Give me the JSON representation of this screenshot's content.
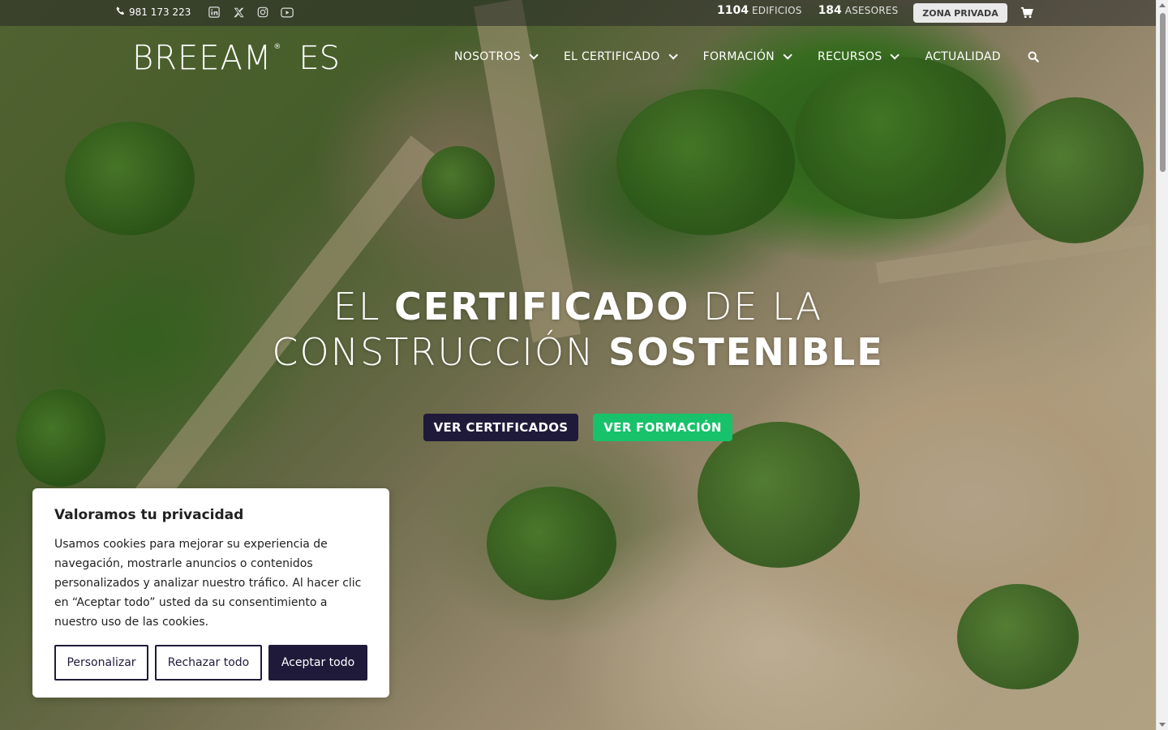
{
  "topbar": {
    "phone": "981 173 223",
    "social_icons": [
      "linkedin-icon",
      "x-icon",
      "instagram-icon",
      "youtube-icon"
    ],
    "stats": [
      {
        "value": "1104",
        "label": "EDIFICIOS"
      },
      {
        "value": "184",
        "label": "ASESORES"
      }
    ],
    "private_zone_label": "ZONA PRIVADA"
  },
  "header": {
    "logo_text": "BREEAM",
    "logo_reg": "®",
    "logo_suffix": "ES",
    "nav": [
      {
        "label": "NOSOTROS",
        "has_dropdown": true
      },
      {
        "label": "EL CERTIFICADO",
        "has_dropdown": true
      },
      {
        "label": "FORMACIÓN",
        "has_dropdown": true
      },
      {
        "label": "RECURSOS",
        "has_dropdown": true
      },
      {
        "label": "ACTUALIDAD",
        "has_dropdown": false
      }
    ]
  },
  "hero": {
    "line1_a": "EL ",
    "line1_b": "CERTIFICADO",
    "line1_c": " DE LA",
    "line2_a": "CONSTRUCCIÓN ",
    "line2_b": "SOSTENIBLE",
    "cta_primary": "VER CERTIFICADOS",
    "cta_secondary": "VER FORMACIÓN"
  },
  "cookie": {
    "title": "Valoramos tu privacidad",
    "body": "Usamos cookies para mejorar su experiencia de navegación, mostrarle anuncios o contenidos personalizados y analizar nuestro tráfico. Al hacer clic en “Aceptar todo” usted da su consentimiento a nuestro uso de las cookies.",
    "btn_customize": "Personalizar",
    "btn_reject": "Rechazar todo",
    "btn_accept": "Aceptar todo"
  },
  "colors": {
    "primary_dark": "#201a3a",
    "accent_green": "#17c26a"
  }
}
